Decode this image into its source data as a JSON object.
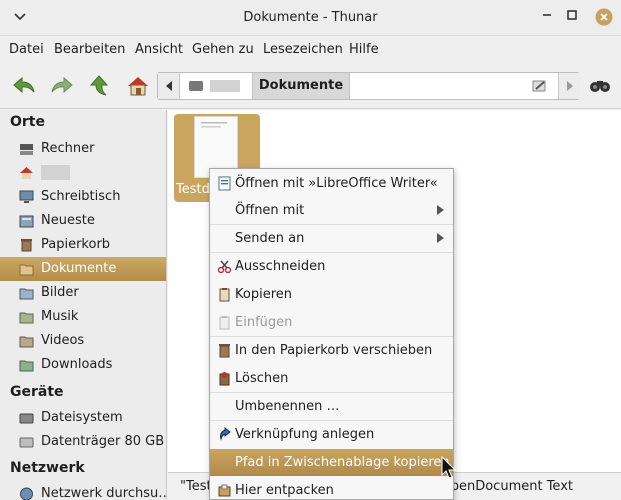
{
  "window": {
    "title": "Dokumente - Thunar"
  },
  "menubar": [
    "Datei",
    "Bearbeiten",
    "Ansicht",
    "Gehen zu",
    "Lesezeichen",
    "Hilfe"
  ],
  "pathbar": {
    "current": "Dokumente"
  },
  "sidebar": {
    "headings": [
      "Orte",
      "Geräte",
      "Netzwerk"
    ],
    "places": [
      {
        "label": "Rechner",
        "icon": "computer-icon"
      },
      {
        "label": "",
        "icon": "home-icon"
      },
      {
        "label": "Schreibtisch",
        "icon": "desktop-icon"
      },
      {
        "label": "Neueste",
        "icon": "recent-icon"
      },
      {
        "label": "Papierkorb",
        "icon": "trash-icon"
      },
      {
        "label": "Dokumente",
        "icon": "folder-icon"
      },
      {
        "label": "Bilder",
        "icon": "folder-icon"
      },
      {
        "label": "Musik",
        "icon": "folder-icon"
      },
      {
        "label": "Videos",
        "icon": "folder-icon"
      },
      {
        "label": "Downloads",
        "icon": "folder-icon"
      }
    ],
    "devices": [
      {
        "label": "Dateisystem",
        "icon": "drive-icon"
      },
      {
        "label": "Datenträger 80 GB",
        "icon": "drive-icon"
      }
    ],
    "network": [
      {
        "label": "Netzwerk durchsu…",
        "icon": "network-icon"
      }
    ]
  },
  "file": {
    "name": "Testd"
  },
  "statusbar": {
    "left": "\"Test",
    "right": "OpenDocument Text"
  },
  "context_menu": [
    {
      "label": "Öffnen mit »LibreOffice Writer«",
      "icon": "writer-icon"
    },
    {
      "label": "Öffnen mit",
      "submenu": true
    },
    {
      "label": "Senden an",
      "submenu": true
    },
    {
      "label": "Ausschneiden",
      "icon": "cut-icon"
    },
    {
      "label": "Kopieren",
      "icon": "copy-icon"
    },
    {
      "label": "Einfügen",
      "icon": "paste-icon",
      "disabled": true
    },
    {
      "label": "In den Papierkorb verschieben",
      "icon": "trash-icon"
    },
    {
      "label": "Löschen",
      "icon": "delete-icon"
    },
    {
      "label": "Umbenennen …"
    },
    {
      "label": "Verknüpfung anlegen",
      "icon": "link-icon"
    },
    {
      "label": "Pfad in Zwischenablage kopieren",
      "highlighted": true
    },
    {
      "label": "Hier entpacken",
      "icon": "extract-icon"
    }
  ],
  "colors": {
    "accent": "#bf9b57",
    "accent_dark": "#b18a4a"
  }
}
